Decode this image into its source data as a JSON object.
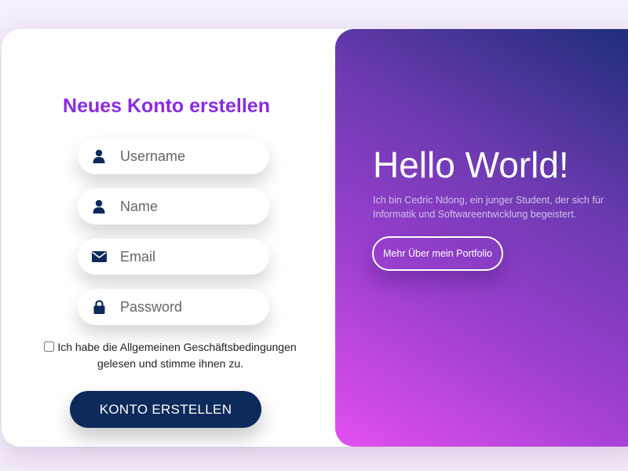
{
  "form": {
    "title": "Neues Konto erstellen",
    "fields": [
      {
        "icon": "user-icon",
        "placeholder": "Username",
        "value": ""
      },
      {
        "icon": "user-icon",
        "placeholder": "Name",
        "value": ""
      },
      {
        "icon": "envelope-icon",
        "placeholder": "Email",
        "value": ""
      },
      {
        "icon": "lock-icon",
        "placeholder": "Password",
        "value": ""
      }
    ],
    "terms_checked": false,
    "terms_label": "Ich habe die Allgemeinen Geschäftsbedingungen gelesen und stimme ihnen zu.",
    "submit_label": "KONTO ERSTELLEN"
  },
  "hero": {
    "title": "Hello World!",
    "text": "Ich bin Cedric Ndong, ein junger Student, der sich für Informatik und Softwareentwicklung begeistert.",
    "button_label": "Mehr Über mein Portfolio"
  },
  "colors": {
    "accent": "#8a2be2",
    "button_dark": "#0d2a5c",
    "icon": "#0d2a5c",
    "gradient_start": "#e34ff0",
    "gradient_end": "#1b2d78"
  }
}
